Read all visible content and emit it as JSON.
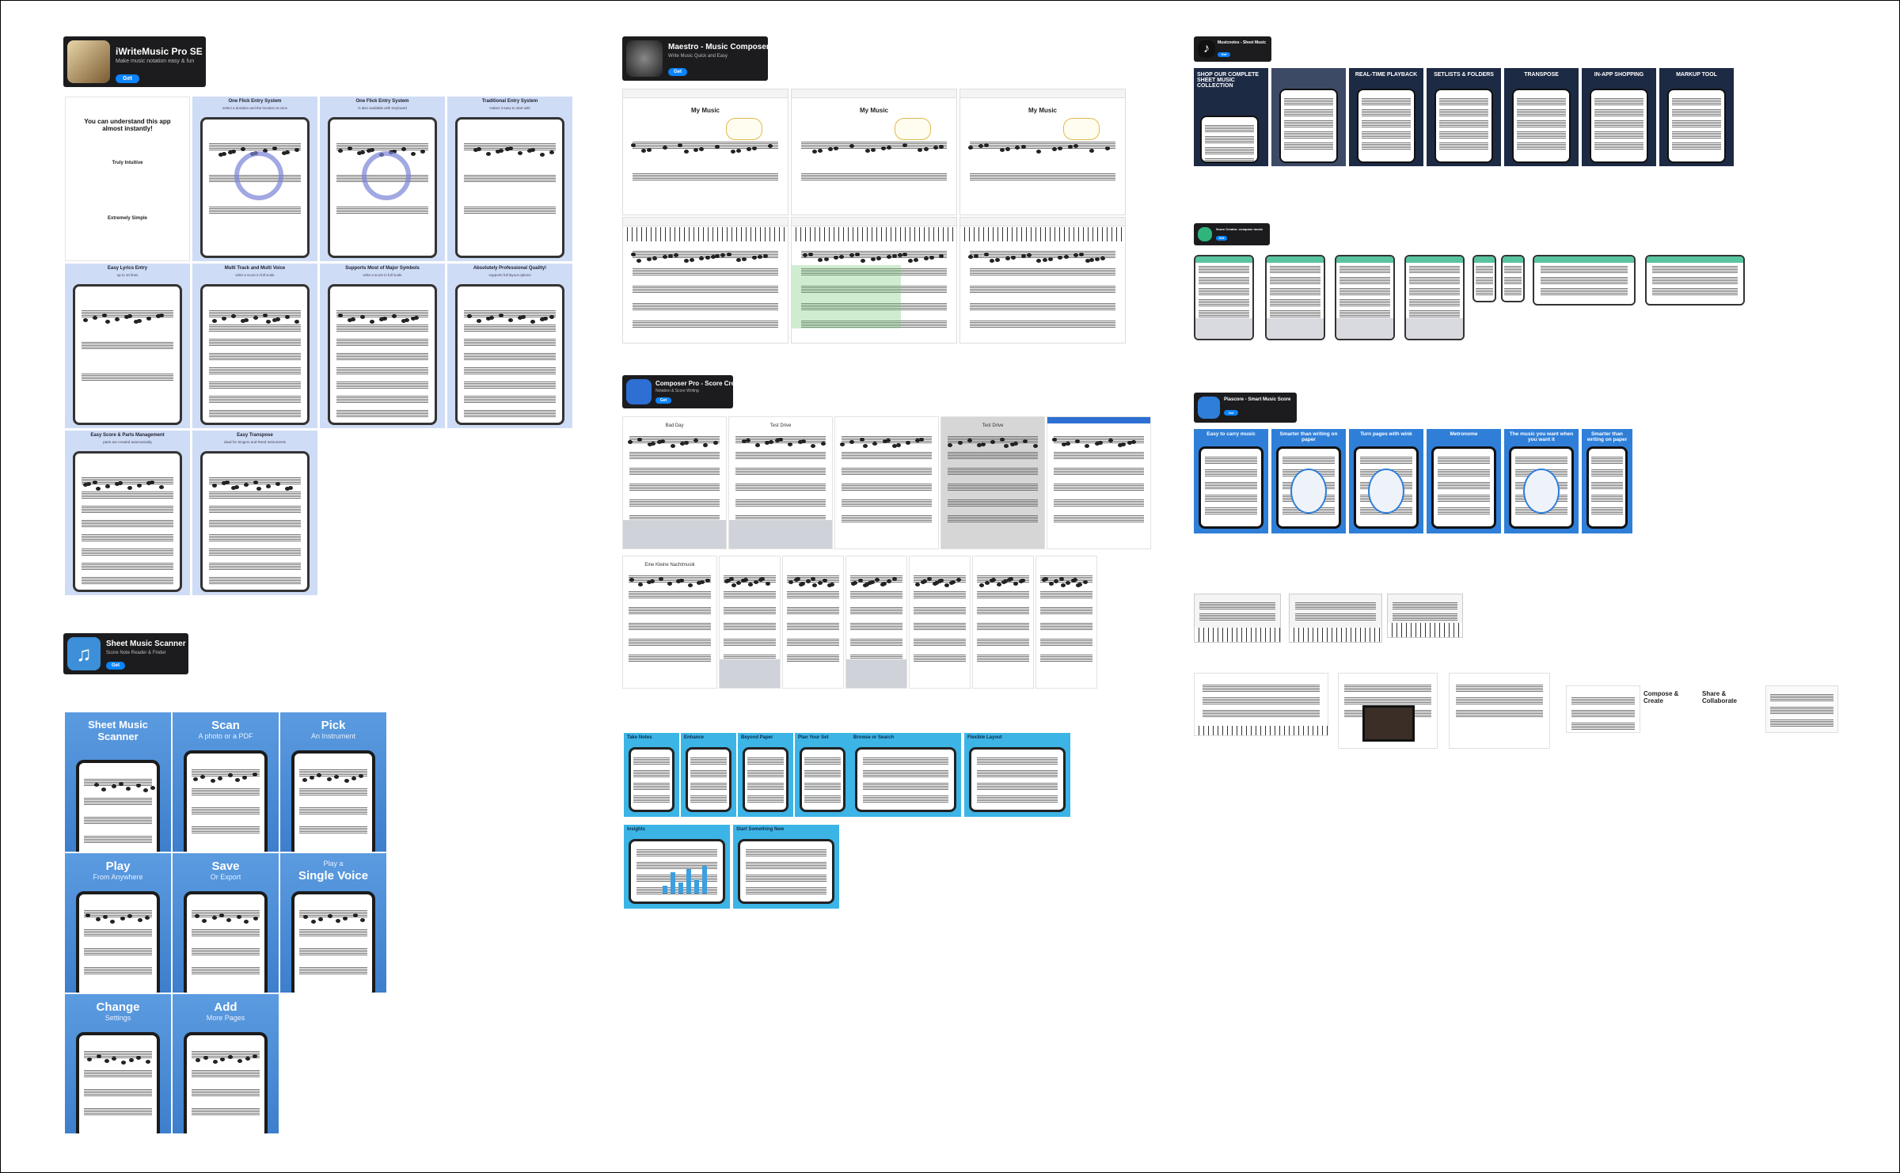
{
  "boards": {
    "iwrite": {
      "title": "iWriteMusic Pro SE",
      "subtitle": "Make music notation easy & fun",
      "get": "Get",
      "tiles": [
        {
          "title": "You can understand this app almost instantly!",
          "sub1": "Truly Intuitive",
          "sub2": "Extremely Simple"
        },
        {
          "title": "One Flick Entry System",
          "sub": "select a duration and the location at once"
        },
        {
          "title": "One Flick Entry System",
          "sub": "is also available with Keyboard"
        },
        {
          "title": "Traditional Entry System",
          "sub": "makes it easy to start with"
        },
        {
          "title": "Easy Lyrics Entry",
          "sub": "up to 10 lines"
        },
        {
          "title": "Multi Track and Multi Voice",
          "sub": "write a score in full scale"
        },
        {
          "title": "Supports Most of Major Symbols",
          "sub": "write a score in full scale"
        },
        {
          "title": "Absolutely Professional Quality!",
          "sub": "supports full layout options"
        },
        {
          "title": "Easy Score & Parts Management",
          "sub": "parts are created automatically"
        },
        {
          "title": "Easy Transpose",
          "sub": "ideal for Singers and Reed Instruments"
        }
      ]
    },
    "scanner": {
      "title": "Sheet Music Scanner",
      "subtitle": "Score Note Reader & Finder",
      "get": "Get",
      "tiles": [
        {
          "big": "Sheet Music Scanner",
          "small": ""
        },
        {
          "big": "Scan",
          "small": "A photo or a PDF"
        },
        {
          "big": "Pick",
          "small": "An Instrument"
        },
        {
          "big": "Play",
          "small": "From Anywhere"
        },
        {
          "big": "Save",
          "small": "Or Export"
        },
        {
          "big": "Single Voice",
          "small": "Play a"
        },
        {
          "big": "Change",
          "small": "Settings"
        },
        {
          "big": "Add",
          "small": "More Pages"
        }
      ]
    },
    "maestro": {
      "title": "Maestro - Music Composer",
      "subtitle": "Write Music Quick and Easy",
      "get": "Get",
      "score_title": "My Music"
    },
    "composerpro": {
      "title": "Composer Pro - Score Creator",
      "subtitle": "Notation & Score Writing",
      "get": "Get",
      "tiles": [
        "Bad Day",
        "Test Drive",
        "",
        "Test Drive",
        "",
        "Eine Kleine Nachtmusik",
        "",
        "",
        "",
        "",
        "",
        ""
      ]
    },
    "scorebook": {
      "tiles": [
        "Take Notes",
        "Enhance",
        "Beyond Paper",
        "Plan Your Set",
        "Browse or Search",
        "Flexible Layout",
        "Insights",
        "Start Something New"
      ]
    },
    "musicnotes": {
      "title": "Musicnotes - Sheet Music",
      "get": "Get",
      "tiles": [
        "SHOP OUR COMPLETE SHEET MUSIC COLLECTION",
        "",
        "REAL-TIME PLAYBACK",
        "SETLISTS & FOLDERS",
        "TRANSPOSE",
        "IN-APP SHOPPING",
        "MARKUP TOOL"
      ]
    },
    "scorecreator": {
      "title": "Score Creator: compose music",
      "get": "Get"
    },
    "piascore": {
      "title": "Piascore - Smart Music Score",
      "get": "Get",
      "tiles": [
        "Easy to carry music",
        "Smarter than writing on paper",
        "Turn pages with wink",
        "Metronome",
        "The music you want when you want it",
        "Smarter than writing on paper"
      ]
    },
    "web": {
      "labels": [
        "Compose & Create",
        "Share & Collaborate"
      ]
    }
  },
  "colors": {
    "dark_banner": "#1c1c1e",
    "get_blue": "#0a84ff",
    "iwrite_blue": "#cfdcf5",
    "scanner_blue": "#5b9be0",
    "scorebook_blue": "#3cb4e6",
    "piascore_blue": "#2f7fd8",
    "musicnotes_navy": "#1d2a44"
  }
}
